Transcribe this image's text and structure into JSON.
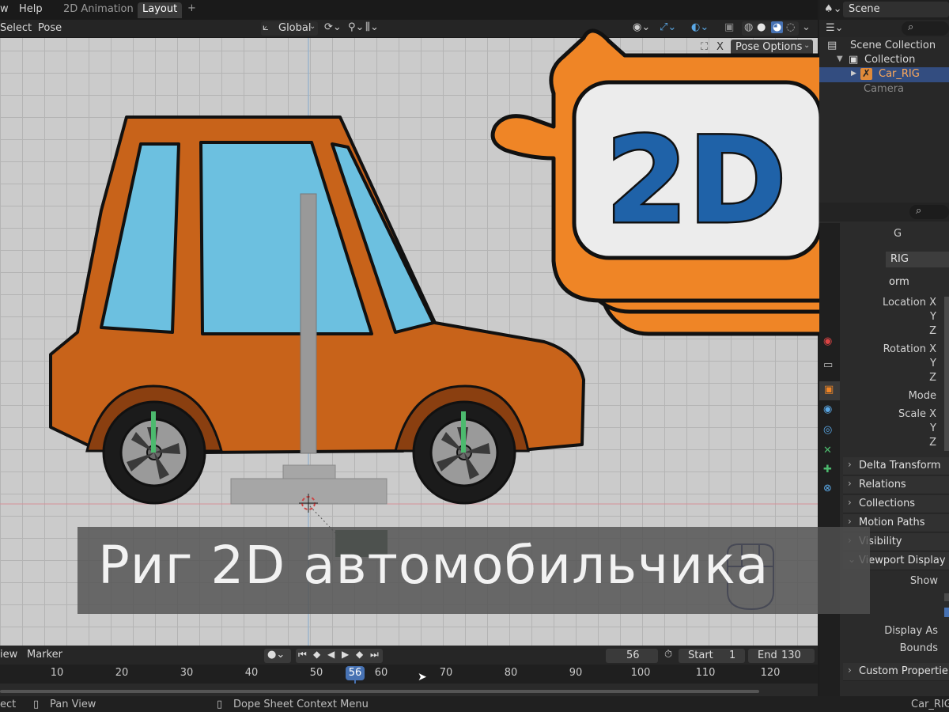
{
  "topbar": {
    "menu_view": "w",
    "menu_help": "Help",
    "tabs": [
      {
        "label": "2D Animation"
      },
      {
        "label": "Layout"
      }
    ],
    "add_tab": "+"
  },
  "header": {
    "select": "Select",
    "pose": "Pose",
    "transform_orientation": "Global",
    "pose_options": "Pose Options",
    "x_label": "X"
  },
  "outliner": {
    "scene_label": "Scene",
    "items": [
      {
        "label": "Scene Collection"
      },
      {
        "label": "Collection"
      },
      {
        "label": "Car_RIG"
      },
      {
        "label": "Camera"
      }
    ]
  },
  "properties": {
    "object_name_fragment": "G",
    "object_field_fragment": "RIG",
    "section_transform": "orm",
    "location_x": "Location X",
    "y1": "Y",
    "z1": "Z",
    "rotation_x": "Rotation X",
    "y2": "Y",
    "z2": "Z",
    "mode": "Mode",
    "scale_x": "Scale X",
    "y3": "Y",
    "z3": "Z",
    "panels": [
      {
        "label": "Delta Transform"
      },
      {
        "label": "Relations"
      },
      {
        "label": "Collections"
      },
      {
        "label": "Motion Paths"
      },
      {
        "label": "Visibility"
      },
      {
        "label": "Viewport Display"
      }
    ],
    "show": "Show",
    "display_as": "Display As",
    "bounds": "Bounds",
    "custom_properties": "Custom Propertie"
  },
  "logo": {
    "text": "2D"
  },
  "banner": {
    "title": "Риг 2D автомобильчика"
  },
  "timeline": {
    "view": "iew",
    "marker": "Marker",
    "current_frame": "56",
    "start_label": "Start",
    "start_value": "1",
    "end_label": "End",
    "end_value": "130",
    "ticks": [
      "10",
      "20",
      "30",
      "40",
      "50",
      "56",
      "60",
      "70",
      "80",
      "90",
      "100",
      "110",
      "120"
    ]
  },
  "statusbar": {
    "select": "ect",
    "pan_view": "Pan View",
    "context_menu": "Dope Sheet Context Menu",
    "active_object": "Car_RIG"
  },
  "colors": {
    "car_body": "#c8631a",
    "window": "#6cc0e0",
    "logo_orange": "#ef8526",
    "logo_blue": "#1f62a8",
    "bone": "#999999",
    "wheel_bone": "#4cba6e",
    "current_frame": "#4772b3"
  }
}
